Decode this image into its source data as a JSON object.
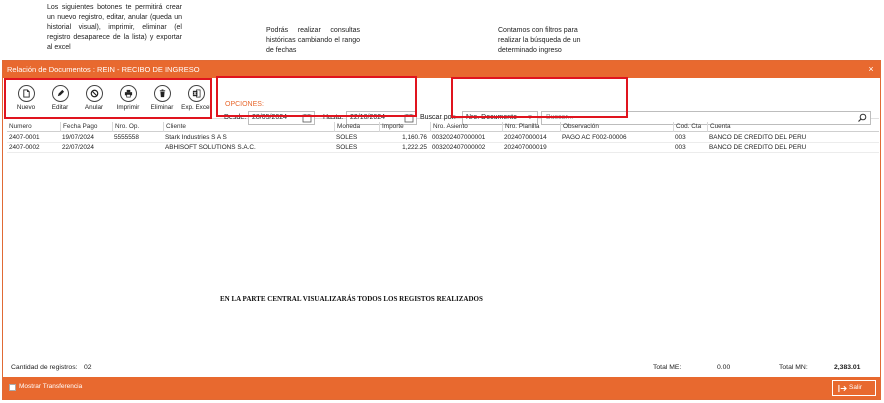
{
  "notes": {
    "buttons": "Los siguientes botones te permitirá crear un nuevo registro, editar, anular (queda un historial visual), imprimir, eliminar (el registro desaparece de la lista) y exportar al excel",
    "dates": "Podrás realizar consultas históricas cambiando el rango de fechas",
    "filters": "Contamos con filtros para realizar la búsqueda de un determinado ingreso"
  },
  "window": {
    "title": "Relación de Documentos : REIN - RECIBO DE INGRESO",
    "close": "×"
  },
  "toolbar": {
    "buttons": [
      {
        "label": "Nuevo",
        "icon": "new-document-icon"
      },
      {
        "label": "Editar",
        "icon": "pencil-icon"
      },
      {
        "label": "Anular",
        "icon": "cancel-icon"
      },
      {
        "label": "Imprimir",
        "icon": "printer-icon"
      },
      {
        "label": "Eliminar",
        "icon": "trash-icon"
      },
      {
        "label": "Exp. Excel",
        "icon": "excel-icon"
      }
    ]
  },
  "options": {
    "title": "OPCIONES:",
    "desde_label": "Desde:",
    "desde_value": "28/05/2024",
    "hasta_label": "Hasta:",
    "hasta_value": "22/10/2024",
    "buscar_label": "Buscar por:",
    "buscar_select": "Nro. Documento",
    "search_placeholder": "Buscar..."
  },
  "table": {
    "columns": [
      "Numero",
      "Fecha Pago",
      "Nro. Op.",
      "Cliente",
      "Moneda",
      "Importe",
      "Nro. Asiento",
      "Nro. Planilla",
      "Observación",
      "Cod. Cta",
      "Cuenta"
    ],
    "rows": [
      [
        "2407-0001",
        "19/07/2024",
        "5555558",
        "Stark Industries S A S",
        "SOLES",
        "1,160.76",
        "003202407000001",
        "202407000014",
        "PAGO AC F002-00006",
        "003",
        "BANCO DE CREDITO DEL PERU"
      ],
      [
        "2407-0002",
        "22/07/2024",
        "",
        "ABHISOFT SOLUTIONS S.A.C.",
        "SOLES",
        "1,222.25",
        "003202407000002",
        "202407000019",
        "",
        "003",
        "BANCO DE CREDITO DEL PERU"
      ]
    ]
  },
  "center_message": "EN LA PARTE CENTRAL VISUALIZARÁS TODOS LOS REGISTOS REALIZADOS",
  "footer": {
    "count_label": "Cantidad de registros:",
    "count_value": "02",
    "total_me_label": "Total ME:",
    "total_me_value": "0.00",
    "total_mn_label": "Total MN:",
    "total_mn_value": "2,383.01"
  },
  "bottom": {
    "checkbox_label": "Mostrar Transferencia",
    "exit_label": "Salir"
  },
  "colors": {
    "accent": "#e8692f",
    "highlight": "#e0141e"
  }
}
